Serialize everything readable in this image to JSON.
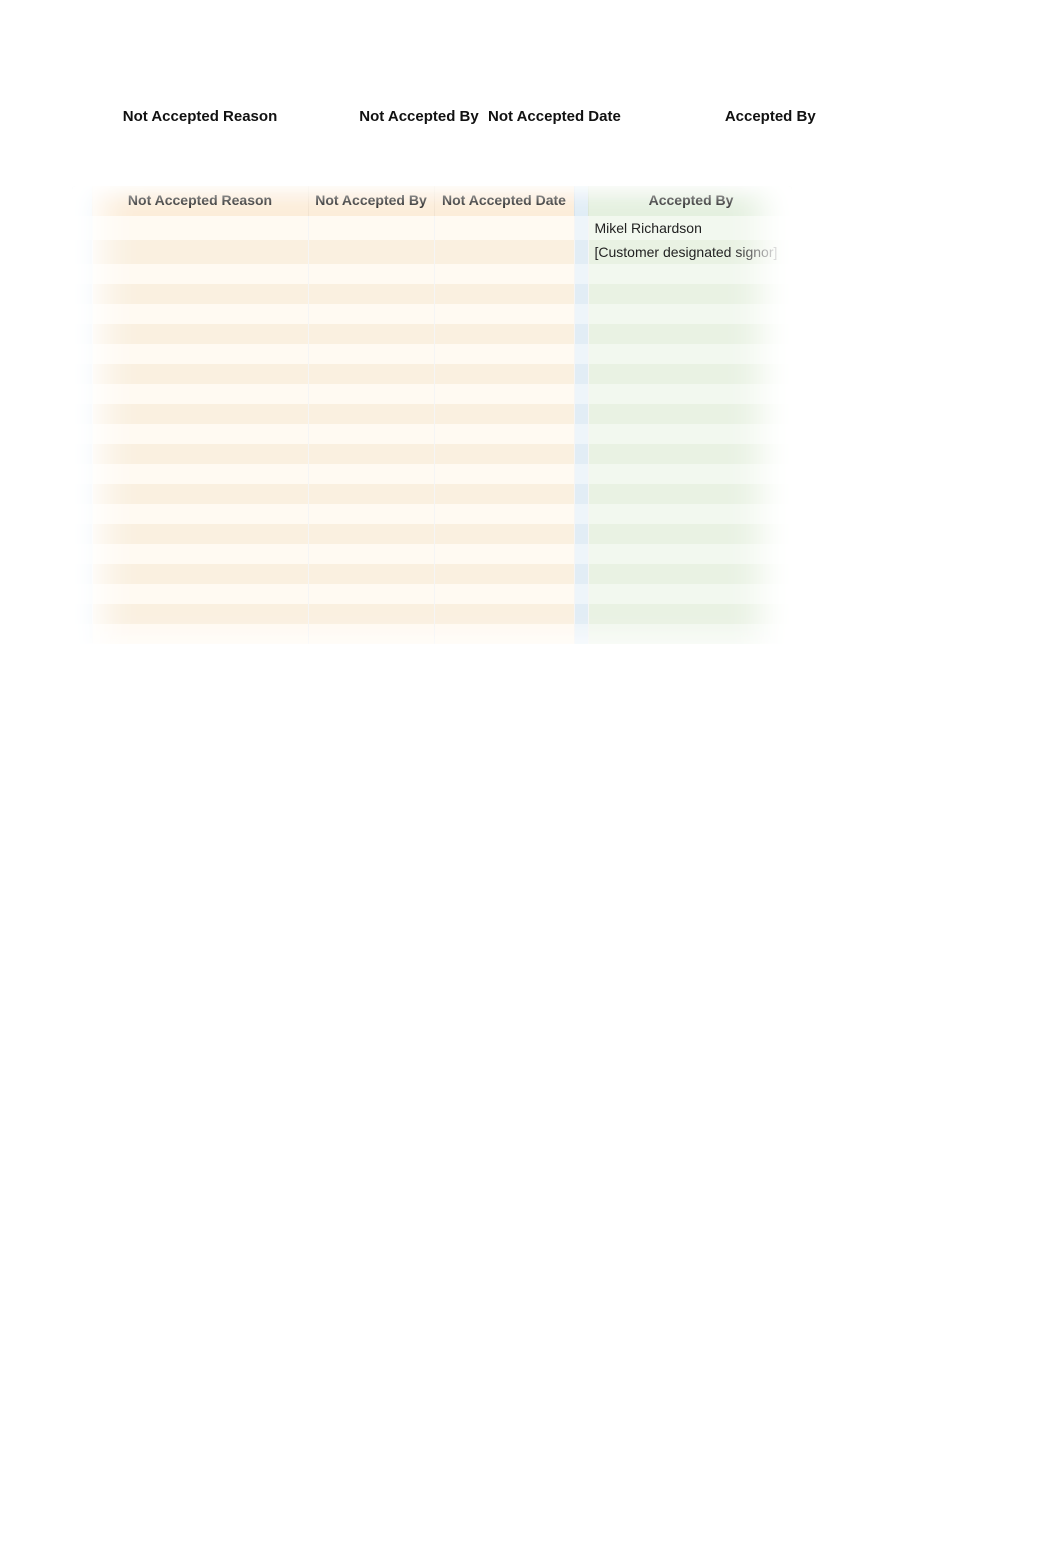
{
  "columns": {
    "not_accepted_reason": "Not Accepted Reason",
    "not_accepted_by": "Not Accepted By",
    "not_accepted_date": "Not Accepted Date",
    "accepted_by": "Accepted By"
  },
  "rows": [
    {
      "not_accepted_reason": "",
      "not_accepted_by": "",
      "not_accepted_date": "",
      "accepted_by": "Mikel Richardson"
    },
    {
      "not_accepted_reason": "",
      "not_accepted_by": "",
      "not_accepted_date": "",
      "accepted_by": "[Customer designated signor]"
    },
    {
      "not_accepted_reason": "",
      "not_accepted_by": "",
      "not_accepted_date": "",
      "accepted_by": ""
    },
    {
      "not_accepted_reason": "",
      "not_accepted_by": "",
      "not_accepted_date": "",
      "accepted_by": ""
    },
    {
      "not_accepted_reason": "",
      "not_accepted_by": "",
      "not_accepted_date": "",
      "accepted_by": ""
    },
    {
      "not_accepted_reason": "",
      "not_accepted_by": "",
      "not_accepted_date": "",
      "accepted_by": ""
    },
    {
      "not_accepted_reason": "",
      "not_accepted_by": "",
      "not_accepted_date": "",
      "accepted_by": ""
    },
    {
      "not_accepted_reason": "",
      "not_accepted_by": "",
      "not_accepted_date": "",
      "accepted_by": ""
    },
    {
      "not_accepted_reason": "",
      "not_accepted_by": "",
      "not_accepted_date": "",
      "accepted_by": ""
    },
    {
      "not_accepted_reason": "",
      "not_accepted_by": "",
      "not_accepted_date": "",
      "accepted_by": ""
    },
    {
      "not_accepted_reason": "",
      "not_accepted_by": "",
      "not_accepted_date": "",
      "accepted_by": ""
    },
    {
      "not_accepted_reason": "",
      "not_accepted_by": "",
      "not_accepted_date": "",
      "accepted_by": ""
    },
    {
      "not_accepted_reason": "",
      "not_accepted_by": "",
      "not_accepted_date": "",
      "accepted_by": ""
    },
    {
      "not_accepted_reason": "",
      "not_accepted_by": "",
      "not_accepted_date": "",
      "accepted_by": ""
    },
    {
      "not_accepted_reason": "",
      "not_accepted_by": "",
      "not_accepted_date": "",
      "accepted_by": ""
    },
    {
      "not_accepted_reason": "",
      "not_accepted_by": "",
      "not_accepted_date": "",
      "accepted_by": ""
    },
    {
      "not_accepted_reason": "",
      "not_accepted_by": "",
      "not_accepted_date": "",
      "accepted_by": ""
    },
    {
      "not_accepted_reason": "",
      "not_accepted_by": "",
      "not_accepted_date": "",
      "accepted_by": ""
    },
    {
      "not_accepted_reason": "",
      "not_accepted_by": "",
      "not_accepted_date": "",
      "accepted_by": ""
    },
    {
      "not_accepted_reason": "",
      "not_accepted_by": "",
      "not_accepted_date": "",
      "accepted_by": ""
    },
    {
      "not_accepted_reason": "",
      "not_accepted_by": "",
      "not_accepted_date": "",
      "accepted_by": ""
    }
  ]
}
